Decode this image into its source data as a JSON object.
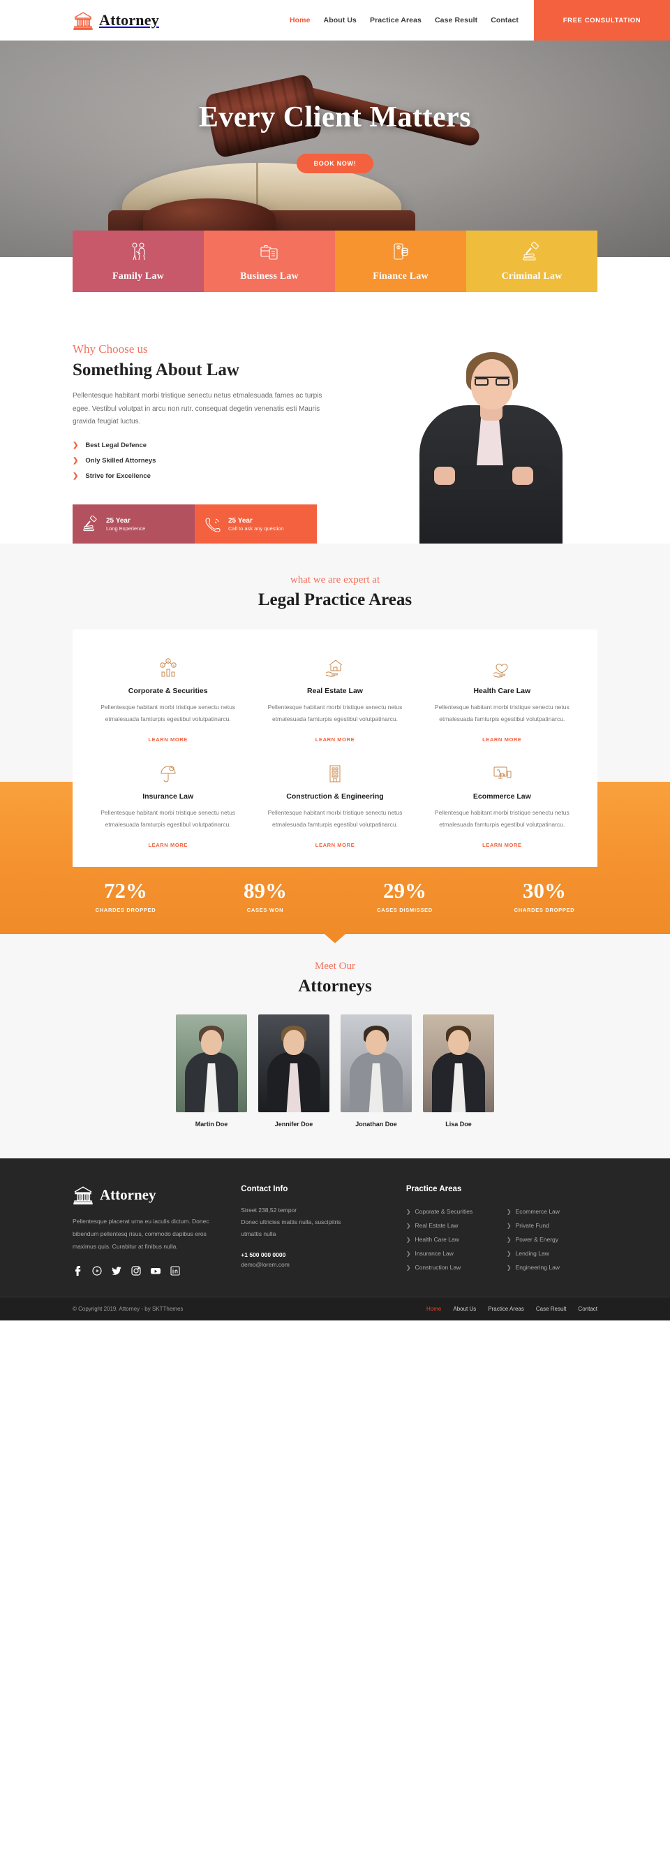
{
  "header": {
    "logo_text": "Attorney",
    "logo_icon": "courthouse-icon",
    "nav": [
      {
        "label": "Home",
        "active": true
      },
      {
        "label": "About Us",
        "active": false
      },
      {
        "label": "Practice Areas",
        "active": false
      },
      {
        "label": "Case Result",
        "active": false
      },
      {
        "label": "Contact",
        "active": false
      }
    ],
    "cta_label": "FREE CONSULTATION",
    "cta_color": "#f4613e"
  },
  "hero": {
    "title": "Every Client Matters",
    "button_label": "BOOK NOW!",
    "slides": 3,
    "active_slide": 3,
    "image_description": "gavel resting on open law book"
  },
  "service_strip": [
    {
      "label": "Family Law",
      "icon": "family-icon",
      "color": "#c8596a"
    },
    {
      "label": "Business Law",
      "icon": "briefcase-document-icon",
      "color": "#f4715e"
    },
    {
      "label": "Finance Law",
      "icon": "money-coins-icon",
      "color": "#f79430"
    },
    {
      "label": "Criminal Law",
      "icon": "gavel-icon",
      "color": "#f0bc3c"
    }
  ],
  "about": {
    "eyebrow": "Why Choose us",
    "title": "Something About Law",
    "paragraph": "Pellentesque habitant morbi tristique senectu netus etmalesuada fames ac turpis egee. Vestibul volutpat in arcu non rutr. consequat degetin venenatis esti Mauris gravida feugiat luctus.",
    "features": [
      "Best Legal Defence",
      "Only Skilled Attorneys",
      "Strive for Excellence"
    ],
    "badges": [
      {
        "title": "25 Year",
        "subtitle": "Long Experience",
        "icon": "gavel-icon",
        "color": "#b4515e"
      },
      {
        "title": "25 Year",
        "subtitle": "Call to ask any question",
        "icon": "phone-ring-icon",
        "color": "#f4613e"
      }
    ]
  },
  "practice": {
    "eyebrow": "what we are expert at",
    "title": "Legal Practice Areas",
    "link_label": "LEARN MORE",
    "items": [
      {
        "name": "Corporate & Securities",
        "icon": "coins-chart-icon",
        "desc": "Pellentesque habitant morbi tristique senectu netus etmalesuada famturpis egestibul volutpatinarcu."
      },
      {
        "name": "Real Estate Law",
        "icon": "house-hand-icon",
        "desc": "Pellentesque habitant morbi tristique senectu netus etmalesuada famturpis egestibul volutpatinarcu."
      },
      {
        "name": "Health Care Law",
        "icon": "heart-hand-icon",
        "desc": "Pellentesque habitant morbi tristique senectu netus etmalesuada famturpis egestibul volutpatinarcu."
      },
      {
        "name": "Insurance Law",
        "icon": "umbrella-shield-icon",
        "desc": "Pellentesque habitant morbi tristique senectu netus etmalesuada famturpis egestibul volutpatinarcu."
      },
      {
        "name": "Construction & Engineering",
        "icon": "building-icon",
        "desc": "Pellentesque habitant morbi tristique senectu netus etmalesuada famturpis egestibul volutpatinarcu."
      },
      {
        "name": "Ecommerce Law",
        "icon": "monitor-cart-icon",
        "desc": "Pellentesque habitant morbi tristique senectu netus etmalesuada famturpis egestibul volutpatinarcu."
      }
    ]
  },
  "chart_data": {
    "type": "bar",
    "title": "",
    "categories": [
      "CHARDES DROPPED",
      "CASES WON",
      "CASES DISMISSED",
      "CHARDES DROPPED"
    ],
    "values": [
      72,
      89,
      29,
      30
    ],
    "value_labels": [
      "72%",
      "89%",
      "29%",
      "30%"
    ],
    "xlabel": "",
    "ylabel": "",
    "ylim": [
      0,
      100
    ],
    "grid": false,
    "legend": "none"
  },
  "team": {
    "eyebrow": "Meet Our",
    "title": "Attorneys",
    "members": [
      {
        "name": "Martin Doe"
      },
      {
        "name": "Jennifer Doe"
      },
      {
        "name": "Jonathan Doe"
      },
      {
        "name": "Lisa Doe"
      }
    ]
  },
  "footer": {
    "logo_text": "Attorney",
    "about": "Pellentesque placerat urna eu iaculis dictum. Donec bibendum pellentesq risus, commodo dapibus eros maximus quis. Curabitur at finibus nulla.",
    "social": [
      {
        "name": "facebook-icon",
        "glyph": "f"
      },
      {
        "name": "google-plus-icon",
        "glyph": "g+"
      },
      {
        "name": "twitter-icon",
        "glyph": "t"
      },
      {
        "name": "instagram-icon",
        "glyph": "ig"
      },
      {
        "name": "youtube-icon",
        "glyph": "yt"
      },
      {
        "name": "linkedin-icon",
        "glyph": "in"
      }
    ],
    "contact": {
      "heading": "Contact Info",
      "address": [
        "Street 238,52 tempor",
        "Donec ultricies mattis nulla, suscipitris",
        "utmattis nulla"
      ],
      "phone": "+1 500 000 0000",
      "email": "demo@lorem.com"
    },
    "practice": {
      "heading": "Practice Areas",
      "links": [
        "Coporate & Securities",
        "Ecommerce Law",
        "Real Estate Law",
        "Private Fund",
        "Health Care Law",
        "Power & Energy",
        "Insurance Law",
        "Lending Law",
        "Construction Law",
        "Engineering Law"
      ]
    },
    "copyright": "© Copyright 2019. Attorney - by SKTThemes",
    "bottom_nav": [
      {
        "label": "Home",
        "active": true
      },
      {
        "label": "About Us",
        "active": false
      },
      {
        "label": "Practice Areas",
        "active": false
      },
      {
        "label": "Case Result",
        "active": false
      },
      {
        "label": "Contact",
        "active": false
      }
    ]
  }
}
